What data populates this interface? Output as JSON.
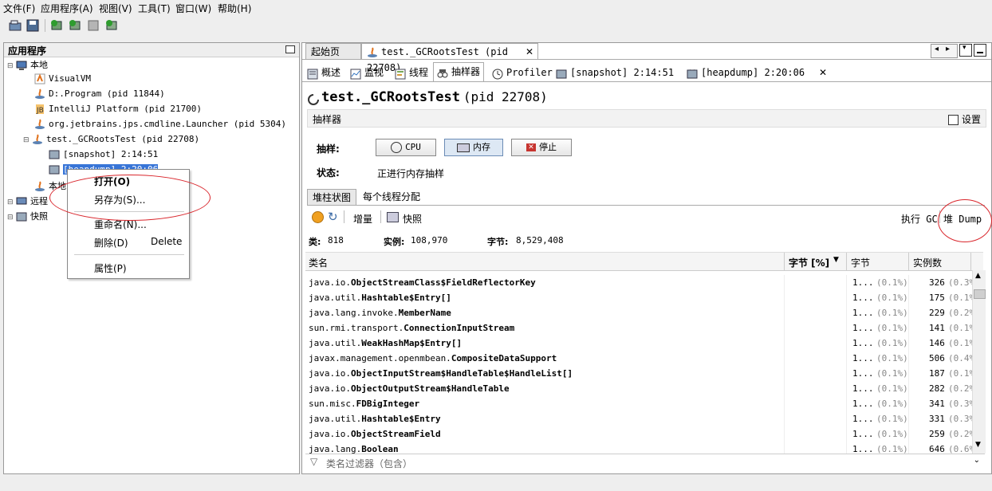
{
  "menu": [
    "文件(F)",
    "应用程序(A)",
    "视图(V)",
    "工具(T)",
    "窗口(W)",
    "帮助(H)"
  ],
  "left": {
    "title": "应用程序",
    "local": "本地",
    "items": [
      "VisualVM",
      "D:.Program (pid 11844)",
      "IntelliJ Platform (pid 21700)",
      "org.jetbrains.jps.cmdline.Launcher (pid 5304)",
      "test._GCRootsTest (pid 22708)"
    ],
    "snapshot": "[snapshot] 2:14:51",
    "heapdump": "[heapdump] 2:20:06",
    "local2": "本地",
    "remote": "远程",
    "snapshots": "快照"
  },
  "context_menu": {
    "open": "打开(O)",
    "save_as": "另存为(S)...",
    "rename": "重命名(N)...",
    "delete": "删除(D)",
    "delete_shortcut": "Delete",
    "properties": "属性(P)"
  },
  "doc_tabs": [
    "起始页",
    "test._GCRootsTest (pid 22708)"
  ],
  "sub_tabs": [
    "概述",
    "监视",
    "线程",
    "抽样器",
    "Profiler",
    "[snapshot] 2:14:51",
    "[heapdump] 2:20:06"
  ],
  "page": {
    "title": "test._GCRootsTest",
    "pid": "(pid 22708)"
  },
  "sampler": {
    "header": "抽样器",
    "settings": "设置",
    "sample_label": "抽样:",
    "cpu_btn": "CPU",
    "mem_btn": "内存",
    "stop_btn": "停止",
    "status_label": "状态:",
    "status_text": "正进行内存抽样"
  },
  "view_tabs": [
    "堆柱状图",
    "每个线程分配"
  ],
  "actions": {
    "delta": "增量",
    "snapshot": "快照",
    "gc": "执行 GC",
    "heapdump": "堆 Dump"
  },
  "summary": {
    "classes_label": "类:",
    "classes": "818",
    "instances_label": "实例:",
    "instances": "108,970",
    "bytes_label": "字节:",
    "bytes": "8,529,408"
  },
  "columns": [
    "类名",
    "字节 [%]",
    "字节",
    "实例数"
  ],
  "rows": [
    {
      "pkg": "java.io.",
      "cls": "ObjectStreamClass$FieldReflectorKey",
      "bytes": "1...",
      "bpct": "(0.1%)",
      "inst": "326",
      "ipct": "(0.3%)"
    },
    {
      "pkg": "java.util.",
      "cls": "Hashtable$Entry[]",
      "bytes": "1...",
      "bpct": "(0.1%)",
      "inst": "175",
      "ipct": "(0.1%)"
    },
    {
      "pkg": "java.lang.invoke.",
      "cls": "MemberName",
      "bytes": "1...",
      "bpct": "(0.1%)",
      "inst": "229",
      "ipct": "(0.2%)"
    },
    {
      "pkg": "sun.rmi.transport.",
      "cls": "ConnectionInputStream",
      "bytes": "1...",
      "bpct": "(0.1%)",
      "inst": "141",
      "ipct": "(0.1%)"
    },
    {
      "pkg": "java.util.",
      "cls": "WeakHashMap$Entry[]",
      "bytes": "1...",
      "bpct": "(0.1%)",
      "inst": "146",
      "ipct": "(0.1%)"
    },
    {
      "pkg": "javax.management.openmbean.",
      "cls": "CompositeDataSupport",
      "bytes": "1...",
      "bpct": "(0.1%)",
      "inst": "506",
      "ipct": "(0.4%)"
    },
    {
      "pkg": "java.io.",
      "cls": "ObjectInputStream$HandleTable$HandleList[]",
      "bytes": "1...",
      "bpct": "(0.1%)",
      "inst": "187",
      "ipct": "(0.1%)"
    },
    {
      "pkg": "java.io.",
      "cls": "ObjectOutputStream$HandleTable",
      "bytes": "1...",
      "bpct": "(0.1%)",
      "inst": "282",
      "ipct": "(0.2%)"
    },
    {
      "pkg": "sun.misc.",
      "cls": "FDBigInteger",
      "bytes": "1...",
      "bpct": "(0.1%)",
      "inst": "341",
      "ipct": "(0.3%)"
    },
    {
      "pkg": "java.util.",
      "cls": "Hashtable$Entry",
      "bytes": "1...",
      "bpct": "(0.1%)",
      "inst": "331",
      "ipct": "(0.3%)"
    },
    {
      "pkg": "java.io.",
      "cls": "ObjectStreamField",
      "bytes": "1...",
      "bpct": "(0.1%)",
      "inst": "259",
      "ipct": "(0.2%)"
    },
    {
      "pkg": "java.lang.",
      "cls": "Boolean",
      "bytes": "1...",
      "bpct": "(0.1%)",
      "inst": "646",
      "ipct": "(0.6%)"
    }
  ],
  "filter_placeholder": "类名过滤器（包含）",
  "colors": {
    "selection": "#3875d7",
    "annotation": "#d9262c"
  }
}
